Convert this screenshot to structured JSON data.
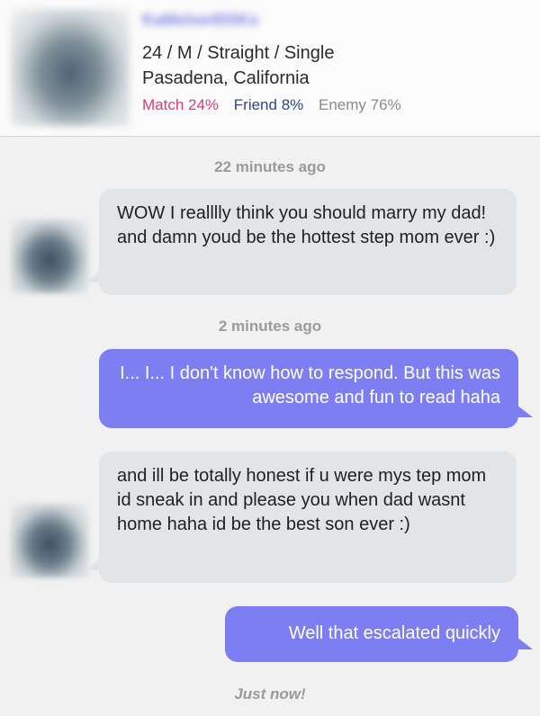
{
  "profile": {
    "username": "KaMeloe45SKs",
    "details": "24 / M / Straight / Single",
    "location": "Pasadena, California",
    "stats": {
      "match": "Match 24%",
      "friend": "Friend 8%",
      "enemy": "Enemy 76%"
    },
    "colors": {
      "match": "#d83a7a",
      "friend": "#2a4a8a",
      "enemy": "#8a8a8a"
    }
  },
  "conversation": {
    "timestamps": [
      "22 minutes ago",
      "2 minutes ago",
      "Just now!"
    ],
    "messages": [
      {
        "direction": "incoming",
        "text": "WOW I realllly think you should marry my dad! and damn youd be the hottest step mom ever :)"
      },
      {
        "direction": "outgoing",
        "text": "I... I... I don't know how to respond. But this was awesome and fun to read haha"
      },
      {
        "direction": "incoming",
        "text": "and ill be totally honest if u were mys tep mom id sneak in and please you when dad wasnt home haha id be the best son ever :)"
      },
      {
        "direction": "outgoing",
        "text": "Well that escalated quickly"
      }
    ],
    "colors": {
      "incoming_bubble": "#e2e5e8",
      "outgoing_bubble": "#7d7ef2"
    }
  }
}
